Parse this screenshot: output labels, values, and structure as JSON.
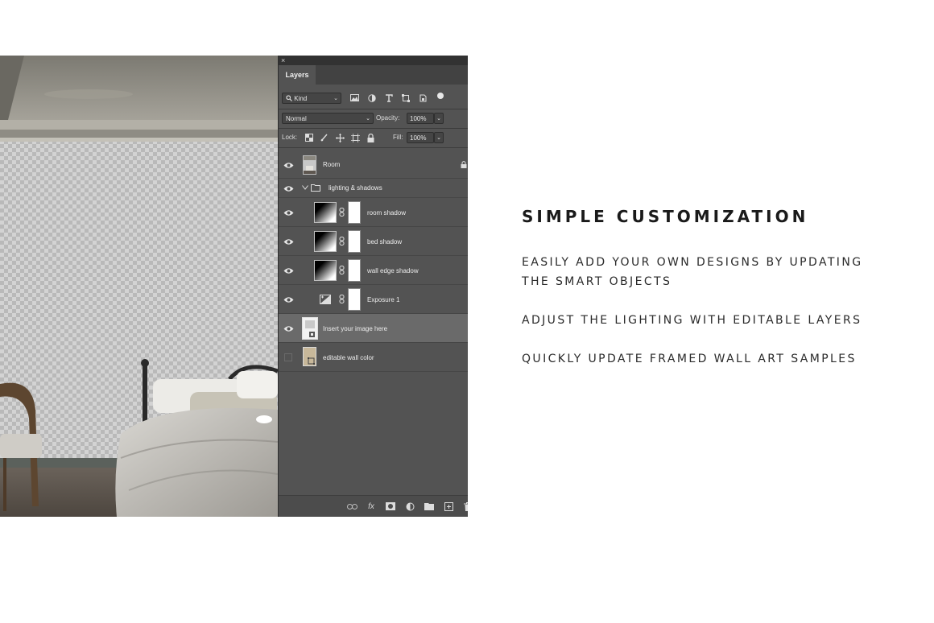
{
  "panel": {
    "close_glyph": "×",
    "tab_title": "Layers",
    "filter_kind": "Kind",
    "blend_mode": "Normal",
    "opacity_label": "Opacity:",
    "opacity_value": "100%",
    "lock_label": "Lock:",
    "fill_label": "Fill:",
    "fill_value": "100%",
    "filter_icons": [
      "image-filter-icon",
      "adjustment-filter-icon",
      "type-filter-icon",
      "shape-filter-icon",
      "smart-object-filter-icon"
    ],
    "bottom_icons": [
      "link-layers-icon",
      "fx-icon",
      "add-mask-icon",
      "adjustment-layer-icon",
      "new-group-icon",
      "new-layer-icon",
      "trash-icon"
    ],
    "fx_glyph": "fx",
    "layers": [
      {
        "name": "Room",
        "visible": true,
        "locked": true
      },
      {
        "name": "lighting & shadows",
        "visible": true,
        "group": true,
        "expanded": true
      },
      {
        "name": "room shadow",
        "visible": true
      },
      {
        "name": "bed shadow",
        "visible": true
      },
      {
        "name": "wall edge shadow",
        "visible": true
      },
      {
        "name": "Exposure 1",
        "visible": true
      },
      {
        "name": "Insert your image here",
        "visible": true,
        "selected": true
      },
      {
        "name": "editable wall color",
        "visible": false
      }
    ]
  },
  "copy": {
    "heading": "SIMPLE CUSTOMIZATION",
    "lines": [
      "Easily add your own designs by updating",
      "the Smart objects",
      "Adjust the lighting with editable layers",
      "Quickly update framed wall art samples"
    ]
  }
}
